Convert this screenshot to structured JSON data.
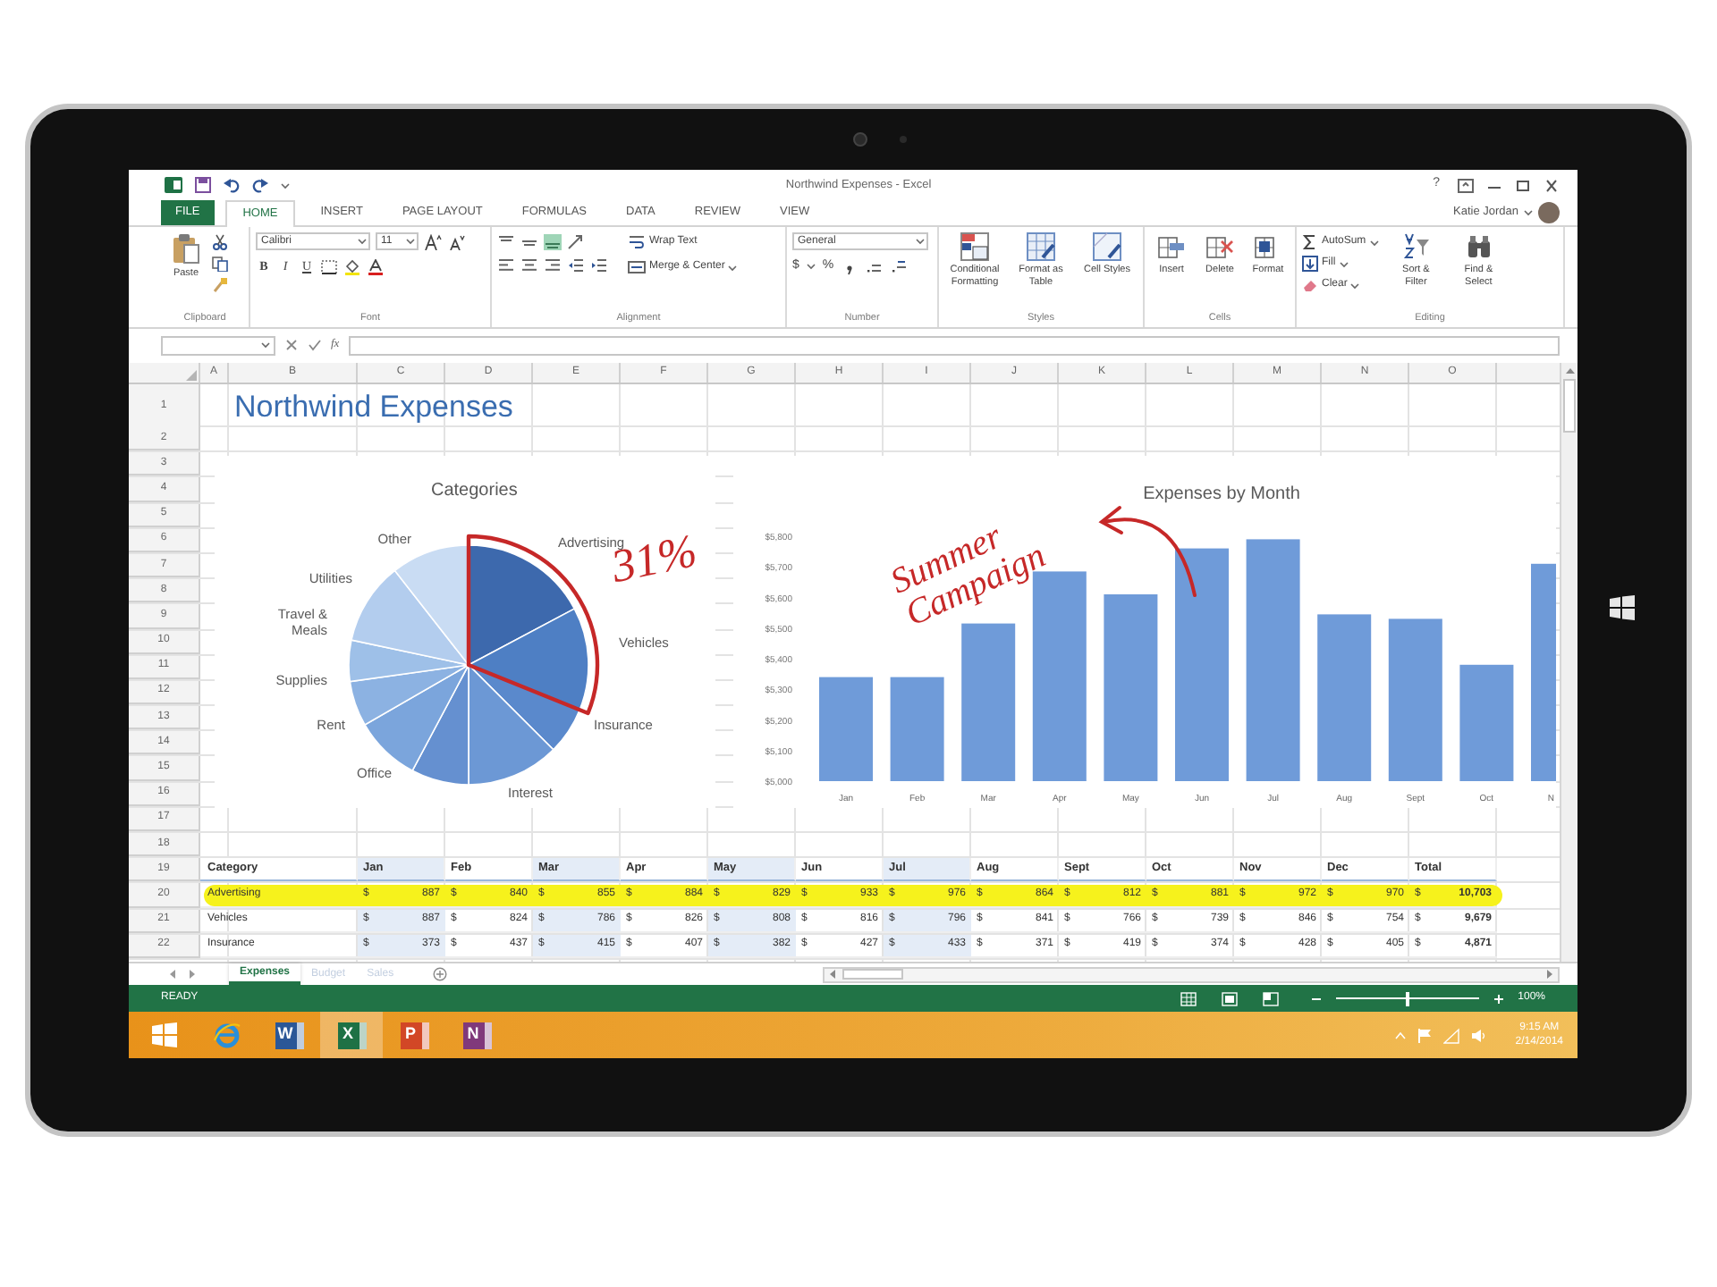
{
  "window": {
    "title": "Northwind Expenses - Excel",
    "help": "?"
  },
  "tabs": [
    {
      "label": "FILE",
      "kind": "file",
      "selected": false
    },
    {
      "label": "HOME",
      "kind": "tab",
      "selected": true
    },
    {
      "label": "INSERT",
      "kind": "tab",
      "selected": false
    },
    {
      "label": "PAGE LAYOUT",
      "kind": "tab",
      "selected": false
    },
    {
      "label": "FORMULAS",
      "kind": "tab",
      "selected": false
    },
    {
      "label": "DATA",
      "kind": "tab",
      "selected": false
    },
    {
      "label": "REVIEW",
      "kind": "tab",
      "selected": false
    },
    {
      "label": "VIEW",
      "kind": "tab",
      "selected": false
    }
  ],
  "user": {
    "name": "Katie Jordan"
  },
  "ribbon": [
    {
      "kind": "clipboard",
      "label": "Clipboard",
      "buttons": [
        "Paste"
      ]
    },
    {
      "kind": "font",
      "label": "Font",
      "font": "Calibri",
      "size": "11",
      "styles": [
        "B",
        "I",
        "U"
      ]
    },
    {
      "kind": "alignment",
      "label": "Alignment",
      "buttons": [
        "Wrap Text",
        "Merge & Center"
      ]
    },
    {
      "kind": "number",
      "label": "Number",
      "format": "General",
      "symbols": [
        "$",
        "%"
      ]
    },
    {
      "kind": "styles",
      "label": "Styles",
      "buttons": [
        "Conditional Formatting",
        "Format as Table",
        "Cell Styles"
      ]
    },
    {
      "kind": "cells",
      "label": "Cells",
      "buttons": [
        "Insert",
        "Delete",
        "Format"
      ]
    },
    {
      "kind": "editing",
      "label": "Editing",
      "buttons": [
        "AutoSum",
        "Fill",
        "Clear",
        "Sort & Filter",
        "Find & Select"
      ]
    }
  ],
  "formula_bar": {
    "function_button": "fx"
  },
  "sheet": {
    "columns": [
      "A",
      "B",
      "C",
      "D",
      "E",
      "F",
      "G",
      "H",
      "I",
      "J",
      "K",
      "L",
      "M",
      "N",
      "O"
    ],
    "rows": [
      "1",
      "2",
      "3",
      "4",
      "5",
      "6",
      "7",
      "8",
      "9",
      "10",
      "11",
      "12",
      "13",
      "14",
      "15",
      "16",
      "17",
      "18",
      "19",
      "20",
      "21",
      "22"
    ],
    "title": "Northwind Expenses",
    "pie": {
      "title": "Categories",
      "labels": [
        "Other",
        "Advertising",
        "Utilities",
        "Travel & Meals",
        "Vehicles",
        "Supplies",
        "Rent",
        "Insurance",
        "Office",
        "Interest"
      ],
      "note": "31%"
    },
    "bar_chart": {
      "note": "Summer Campaign",
      "chart_data": {
        "type": "bar",
        "title": "Expenses by Month",
        "categories": [
          "Jan",
          "Feb",
          "Mar",
          "Apr",
          "May",
          "Jun",
          "Jul",
          "Aug",
          "Sept",
          "Oct",
          "N"
        ],
        "values": [
          5340,
          5340,
          5515,
          5685,
          5610,
          5760,
          5790,
          5545,
          5530,
          5380,
          5710
        ],
        "ylim": [
          5000,
          5800
        ],
        "yticks": [
          {
            "value": 5000,
            "label": "$5,000"
          },
          {
            "value": 5100,
            "label": "$5,100"
          },
          {
            "value": 5200,
            "label": "$5,200"
          },
          {
            "value": 5300,
            "label": "$5,300"
          },
          {
            "value": 5400,
            "label": "$5,400"
          },
          {
            "value": 5500,
            "label": "$5,500"
          },
          {
            "value": 5600,
            "label": "$5,600"
          },
          {
            "value": 5700,
            "label": "$5,700"
          },
          {
            "value": 5800,
            "label": "$5,800"
          }
        ]
      }
    },
    "table": {
      "header": [
        {
          "text": "Category",
          "shaded": false
        },
        {
          "text": "Jan",
          "shaded": true
        },
        {
          "text": "Feb",
          "shaded": false
        },
        {
          "text": "Mar",
          "shaded": true
        },
        {
          "text": "Apr",
          "shaded": false
        },
        {
          "text": "May",
          "shaded": true
        },
        {
          "text": "Jun",
          "shaded": false
        },
        {
          "text": "Jul",
          "shaded": true
        },
        {
          "text": "Aug",
          "shaded": false
        },
        {
          "text": "Sept",
          "shaded": false
        },
        {
          "text": "Oct",
          "shaded": false
        },
        {
          "text": "Nov",
          "shaded": false
        },
        {
          "text": "Dec",
          "shaded": false
        },
        {
          "text": "Total",
          "shaded": false
        }
      ],
      "rows": [
        {
          "highlighted": true,
          "cells": [
            "Advertising",
            "$ 887",
            "$ 840",
            "$ 855",
            "$ 884",
            "$ 829",
            "$ 933",
            "$ 976",
            "$ 864",
            "$ 812",
            "$ 881",
            "$ 972",
            "$ 970",
            "$ **10,703**"
          ]
        },
        {
          "highlighted": false,
          "cells": [
            "Vehicles",
            "$ 887",
            "$ 824",
            "$ 786",
            "$ 826",
            "$ 808",
            "$ 816",
            "$ 796",
            "$ 841",
            "$ 766",
            "$ 739",
            "$ 846",
            "$ 754",
            "$ **9,679**"
          ]
        },
        {
          "highlighted": false,
          "cells": [
            "Insurance",
            "$ 373",
            "$ 437",
            "$ 415",
            "$ 407",
            "$ 382",
            "$ 427",
            "$ 433",
            "$ 371",
            "$ 419",
            "$ 374",
            "$ 428",
            "$ 405",
            "$ **4,871**"
          ]
        }
      ]
    }
  },
  "sheet_tabs": [
    {
      "label": "Expenses",
      "selected": true
    },
    {
      "label": "Budget",
      "selected": false
    },
    {
      "label": "Sales",
      "selected": false
    }
  ],
  "status_bar": {
    "text": "READY",
    "zoom": "100%",
    "level": 0.5
  },
  "taskbar": {
    "apps": [
      {
        "kind": "start",
        "selected": false
      },
      {
        "kind": "browser",
        "selected": false
      },
      {
        "kind": "office",
        "letter": "W",
        "color": "#2b5797",
        "selected": false
      },
      {
        "kind": "office",
        "letter": "X",
        "color": "#1e7145",
        "selected": true
      },
      {
        "kind": "office",
        "letter": "P",
        "color": "#d24726",
        "selected": false
      },
      {
        "kind": "office",
        "letter": "N",
        "color": "#80397b",
        "selected": false
      }
    ],
    "time": "9:15 AM",
    "date": "2/14/2014"
  }
}
